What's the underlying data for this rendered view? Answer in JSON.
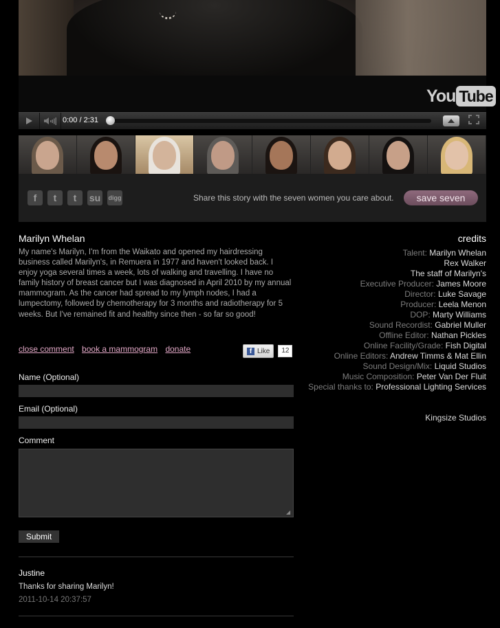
{
  "player": {
    "youtube_brand_left": "You",
    "youtube_brand_right": "Tube",
    "time": "0:00 / 2:31",
    "progress": 0,
    "play_icon": "play-icon",
    "volume_icon": "volume-icon",
    "quality_icon": "quality-icon",
    "fullscreen_icon": "fullscreen-icon"
  },
  "thumbnails": [
    {
      "active": false,
      "skin": "#c9a58e",
      "hair": "#6b5a4a"
    },
    {
      "active": false,
      "skin": "#b88a6e",
      "hair": "#1a1310"
    },
    {
      "active": true,
      "skin": "#d3b49b",
      "hair": "#e8e3dc"
    },
    {
      "active": false,
      "skin": "#c09a86",
      "hair": "#5e5b58"
    },
    {
      "active": false,
      "skin": "#a57659",
      "hair": "#1b1411"
    },
    {
      "active": false,
      "skin": "#d2ab8f",
      "hair": "#3c2a1e"
    },
    {
      "active": false,
      "skin": "#c7a088",
      "hair": "#141110"
    },
    {
      "active": false,
      "skin": "#e2c2a9",
      "hair": "#d8b777"
    }
  ],
  "share": {
    "icons": [
      {
        "name": "facebook-icon",
        "glyph": "f"
      },
      {
        "name": "twitter-icon",
        "glyph": "t"
      },
      {
        "name": "tumblr-icon",
        "glyph": "t"
      },
      {
        "name": "stumbleupon-icon",
        "glyph": "su"
      },
      {
        "name": "digg-icon",
        "glyph": "digg"
      }
    ],
    "text": "Share this story with the seven women you care about.",
    "save_label": "save seven"
  },
  "story": {
    "name": "Marilyn Whelan",
    "bio": "My name's Marilyn, I'm from the Waikato and opened my hairdressing business called Marilyn's, in Remuera in 1977 and haven't looked back. I enjoy yoga several times a week, lots of walking and travelling. I have no family history of breast cancer but I was diagnosed in April 2010 by my annual mammogram. As the cancer had spread to my lymph nodes, I had a lumpectomy, followed by chemotherapy for 3 months and radiotherapy for 5 weeks. But I've remained fit and healthy since then - so far so good!",
    "links": {
      "close_comment": "close comment",
      "book_mammogram": "book a mammogram",
      "donate": "donate"
    },
    "fb": {
      "like_label": "Like",
      "count": "12"
    }
  },
  "form": {
    "name_label": "Name (Optional)",
    "email_label": "Email (Optional)",
    "comment_label": "Comment",
    "name_value": "",
    "email_value": "",
    "comment_value": "",
    "submit_label": "Submit"
  },
  "comments": [
    {
      "author": "Justine",
      "text": "Thanks for sharing Marilyn!",
      "date": "2011-10-14 20:37:57"
    }
  ],
  "credits": {
    "title": "credits",
    "rows": [
      {
        "role": "Talent: ",
        "who": "Marilyn Whelan"
      },
      {
        "role": "",
        "who": "Rex Walker"
      },
      {
        "role": "",
        "who": "The staff of Marilyn's"
      },
      {
        "role": "Executive Producer: ",
        "who": "James Moore"
      },
      {
        "role": "Director: ",
        "who": "Luke Savage"
      },
      {
        "role": "Producer: ",
        "who": "Leela Menon"
      },
      {
        "role": "DOP: ",
        "who": "Marty Williams"
      },
      {
        "role": "Sound Recordist: ",
        "who": "Gabriel Muller"
      },
      {
        "role": "Offline Editor: ",
        "who": "Nathan Pickles"
      },
      {
        "role": "Online Facility/Grade: ",
        "who": "Fish Digital"
      },
      {
        "role": "Online Editors: ",
        "who": "Andrew Timms & Mat Ellin"
      },
      {
        "role": "Sound Design/Mix: ",
        "who": "Liquid Studios"
      },
      {
        "role": "Music Composition: ",
        "who": "Peter Van Der Fluit"
      },
      {
        "role": "Special thanks to: ",
        "who": "Professional Lighting Services"
      }
    ],
    "studio": "Kingsize Studios"
  }
}
